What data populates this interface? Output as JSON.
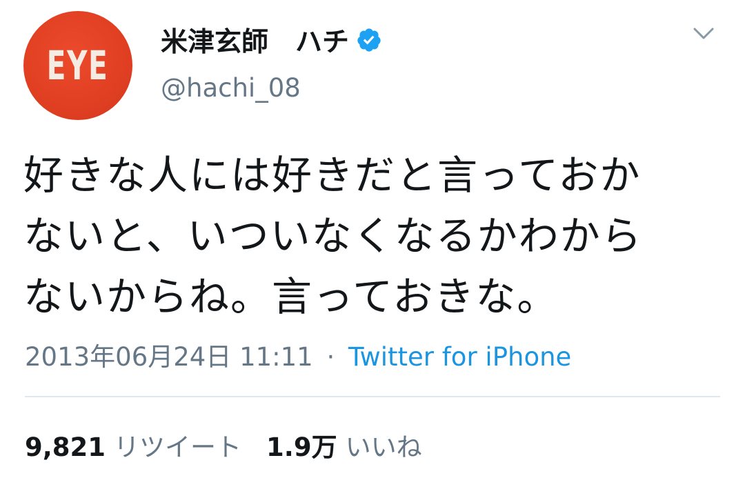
{
  "user": {
    "avatar_text": "EYE",
    "display_name": "米津玄師　ハチ",
    "handle": "@hachi_08",
    "verified": true
  },
  "tweet": {
    "text_lines": [
      "好きな人には好きだと言っておか",
      "ないと、いついなくなるかわから",
      "ないからね。言っておきな。"
    ],
    "timestamp": "2013年06月24日 11:11",
    "separator": "·",
    "source": "Twitter for iPhone"
  },
  "stats": {
    "retweets_count": "9,821",
    "retweets_label": "リツイート",
    "likes_count": "1.9万",
    "likes_label": "いいね"
  },
  "colors": {
    "avatar_red": "#e03f22",
    "verified_blue": "#1da1f2",
    "link_blue": "#1b95e0",
    "secondary_text": "#657786",
    "primary_text": "#14171a"
  },
  "icons": {
    "verified": "verified-badge-icon",
    "menu": "chevron-down-icon"
  }
}
